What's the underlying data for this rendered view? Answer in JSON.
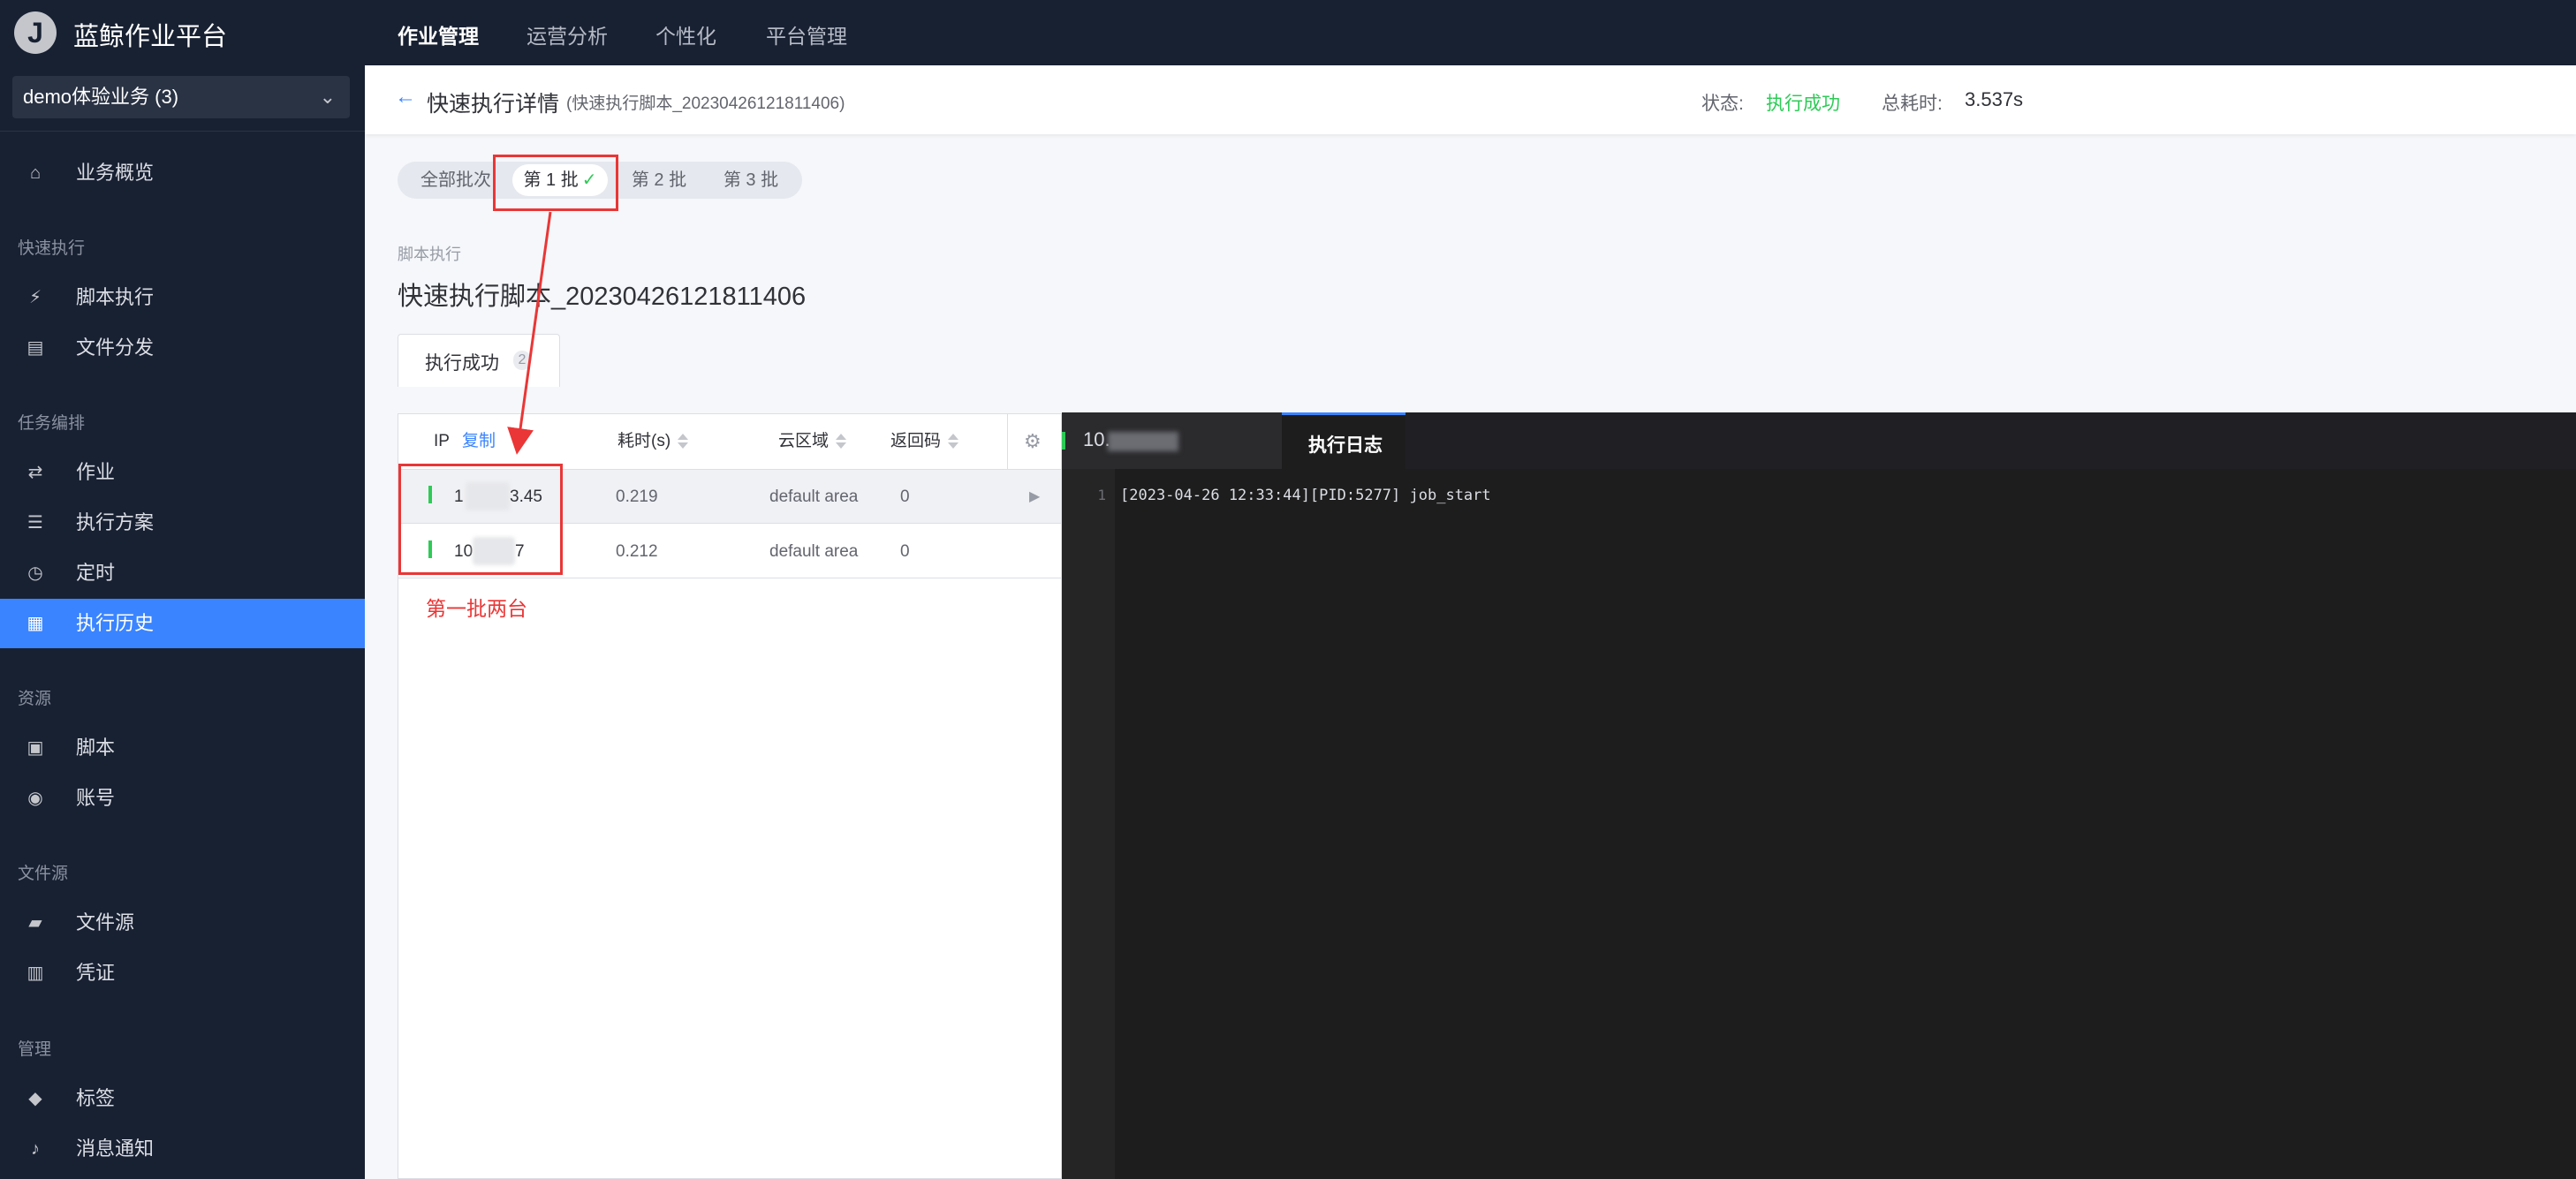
{
  "app": {
    "logo": "J",
    "title": "蓝鲸作业平台"
  },
  "topnav": [
    "作业管理",
    "运营分析",
    "个性化",
    "平台管理"
  ],
  "sidebar": {
    "business": "demo体验业务 (3)",
    "home": "业务概览",
    "groups": {
      "quick": "快速执行",
      "task": "任务编排",
      "resource": "资源",
      "filesource": "文件源",
      "manage": "管理"
    },
    "items": {
      "script_exec": "脚本执行",
      "file_dist": "文件分发",
      "job": "作业",
      "plan": "执行方案",
      "cron": "定时",
      "history": "执行历史",
      "script": "脚本",
      "account": "账号",
      "file_source": "文件源",
      "ticket": "凭证",
      "tag": "标签",
      "notify": "消息通知"
    }
  },
  "header": {
    "title": "快速执行详情",
    "subtitle": "(快速执行脚本_20230426121811406)",
    "status_label": "状态:",
    "status_value": "执行成功",
    "duration_label": "总耗时:",
    "duration_value": "3.537s"
  },
  "batches": [
    "全部批次",
    "第 1 批",
    "第 2 批",
    "第 3 批"
  ],
  "step": {
    "type": "脚本执行",
    "name": "快速执行脚本_20230426121811406"
  },
  "result_tab": {
    "label": "执行成功",
    "count": "2"
  },
  "table": {
    "columns": {
      "ip": "IP",
      "copy": "复制",
      "duration": "耗时(s)",
      "cloud": "云区域",
      "code": "返回码"
    },
    "rows": [
      {
        "ip_head": "1",
        "ip_tail": "3.45",
        "duration": "0.219",
        "cloud": "default area",
        "code": "0"
      },
      {
        "ip_head": "10",
        "ip_tail": "7",
        "duration": "0.212",
        "cloud": "default area",
        "code": "0"
      }
    ]
  },
  "annotation": "第一批两台",
  "log": {
    "host_tab": "10.",
    "log_tab": "执行日志",
    "lines": [
      {
        "no": "1",
        "text": "[2023-04-26 12:33:44][PID:5277] job_start"
      }
    ]
  },
  "colors": {
    "nav_bg": "#182132",
    "accent": "#3a84ff",
    "success": "#2dcb56",
    "annotation": "#ea3636"
  }
}
